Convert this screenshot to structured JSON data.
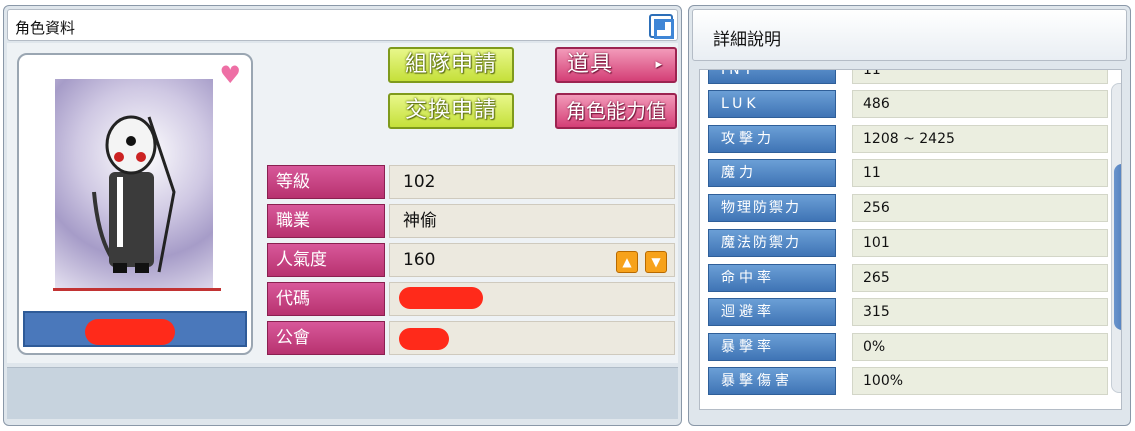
{
  "character_window": {
    "title": "角色資料",
    "buttons": {
      "party_request": "組隊申請",
      "trade_request": "交換申請",
      "item": "道具",
      "item_arrow": "▸",
      "stats": "角色能力值"
    },
    "info_rows": [
      {
        "label": "等級",
        "value": "102"
      },
      {
        "label": "職業",
        "value": "神偷"
      },
      {
        "label": "人氣度",
        "value": "160"
      },
      {
        "label": "代碼",
        "value": ""
      },
      {
        "label": "公會",
        "value": ""
      }
    ],
    "fame_buttons": {
      "up": "▲",
      "down": "▼"
    },
    "heart": "♥"
  },
  "detail_window": {
    "title": "詳細說明",
    "stats": [
      {
        "label": "INT",
        "value": "11"
      },
      {
        "label": "LUK",
        "value": "486"
      },
      {
        "label": "攻擊力",
        "value": "1208 ~ 2425"
      },
      {
        "label": "魔力",
        "value": "11"
      },
      {
        "label": "物理防禦力",
        "value": "256"
      },
      {
        "label": "魔法防禦力",
        "value": "101"
      },
      {
        "label": "命中率",
        "value": "265"
      },
      {
        "label": "迴避率",
        "value": "315"
      },
      {
        "label": "暴擊率",
        "value": "0%"
      },
      {
        "label": "暴擊傷害",
        "value": "100%"
      }
    ]
  },
  "colors": {
    "green_button": "#c5e03a",
    "red_button": "#d43f76",
    "info_label": "#b8326f",
    "stat_label": "#3f74b5",
    "fame_button": "#f7a21b",
    "redaction": "#ff2a1a"
  },
  "icons": [
    "heart-icon",
    "close-icon",
    "arrow-right-icon",
    "fame-up-icon",
    "fame-down-icon"
  ]
}
